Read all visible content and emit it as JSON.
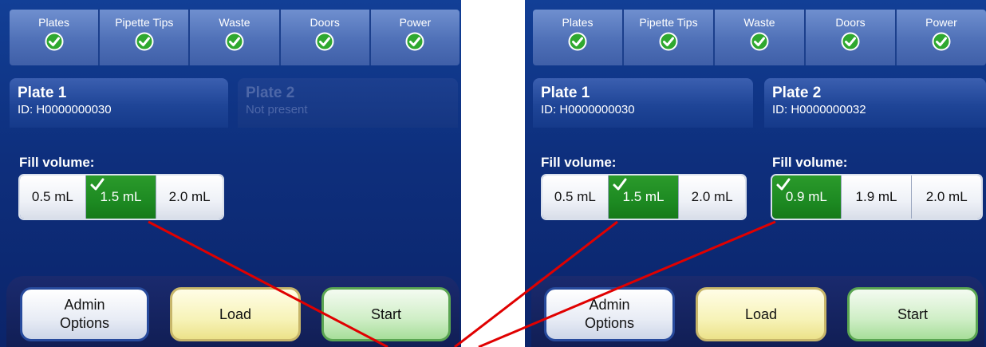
{
  "status_bar": {
    "items": [
      {
        "label": "Plates",
        "icon": "check-icon"
      },
      {
        "label": "Pipette Tips",
        "icon": "check-icon"
      },
      {
        "label": "Waste",
        "icon": "check-icon"
      },
      {
        "label": "Doors",
        "icon": "check-icon"
      },
      {
        "label": "Power",
        "icon": "check-icon"
      }
    ]
  },
  "left_screen": {
    "plate1": {
      "title": "Plate 1",
      "id": "ID: H0000000030"
    },
    "plate2": {
      "title": "Plate 2",
      "id": "Not present"
    },
    "fill_label": "Fill volume:",
    "volumes": [
      {
        "label": "0.5 mL",
        "selected": false
      },
      {
        "label": "1.5 mL",
        "selected": true
      },
      {
        "label": "2.0 mL",
        "selected": false
      }
    ],
    "buttons": {
      "admin_line1": "Admin",
      "admin_line2": "Options",
      "load": "Load",
      "start": "Start"
    }
  },
  "right_screen": {
    "plate1": {
      "title": "Plate 1",
      "id": "ID: H0000000030"
    },
    "plate2": {
      "title": "Plate 2",
      "id": "ID: H0000000032"
    },
    "fill_label_1": "Fill volume:",
    "fill_label_2": "Fill volume:",
    "volumes_plate1": [
      {
        "label": "0.5 mL",
        "selected": false
      },
      {
        "label": "1.5 mL",
        "selected": true
      },
      {
        "label": "2.0 mL",
        "selected": false
      }
    ],
    "volumes_plate2": [
      {
        "label": "0.9 mL",
        "selected": true
      },
      {
        "label": "1.9 mL",
        "selected": false
      },
      {
        "label": "2.0 mL",
        "selected": false
      }
    ],
    "buttons": {
      "admin_line1": "Admin",
      "admin_line2": "Options",
      "load": "Load",
      "start": "Start"
    }
  },
  "colors": {
    "background": "#0e2f7d",
    "selected_green": "#1d8a22",
    "annotation_red": "#e00000",
    "check_green": "#2fa82f"
  }
}
